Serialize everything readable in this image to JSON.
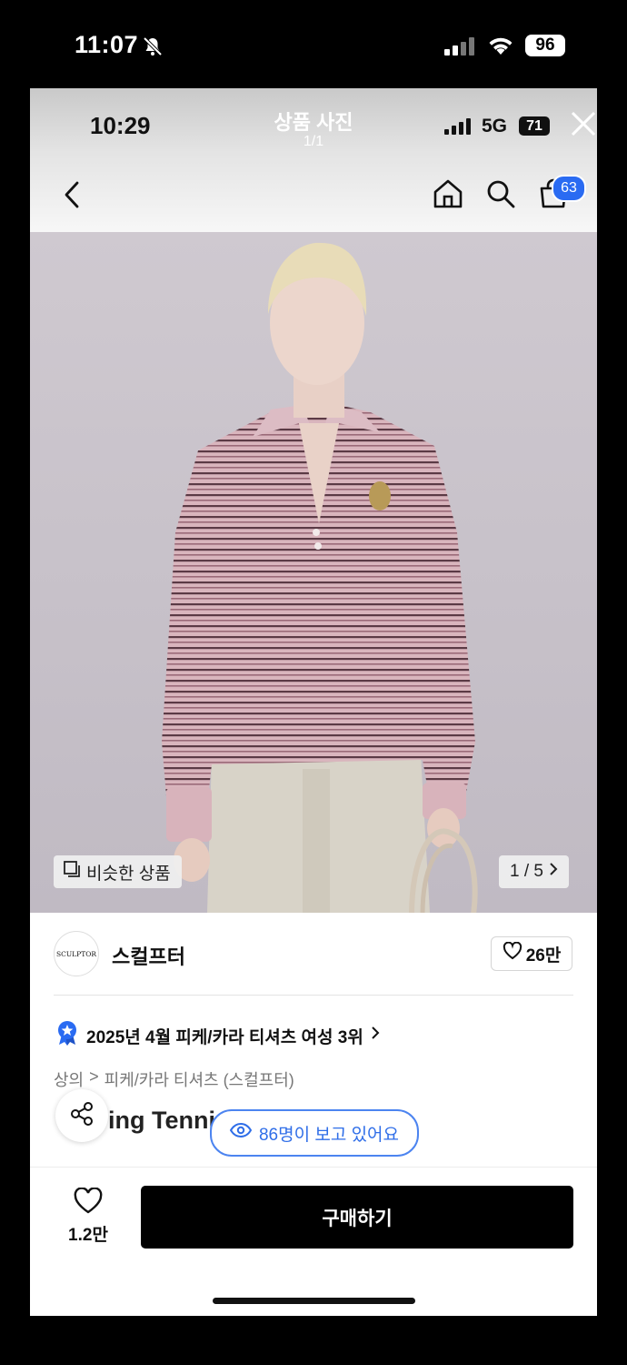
{
  "outer_status": {
    "time": "11:07",
    "battery": "96"
  },
  "inner_status": {
    "time": "10:29",
    "network": "5G",
    "battery": "71"
  },
  "viewer": {
    "title": "상품 사진",
    "counter": "1/1"
  },
  "nav": {
    "cart_count": "63",
    "icons": [
      "back-arrow-icon",
      "home-icon",
      "search-icon",
      "cart-icon"
    ]
  },
  "photo": {
    "similar_label": "비슷한 상품",
    "page_indicator": "1 / 5"
  },
  "brand": {
    "logo_text": "SCULPTOR",
    "name": "스컬프터",
    "likes": "26만"
  },
  "ranking": {
    "text": "2025년 4월 피케/카라 티셔츠 여성 3위"
  },
  "breadcrumb": {
    "level1": "상의",
    "separator": ">",
    "level2": "피케/카라 티셔츠 (스컬프터)"
  },
  "product": {
    "name_partial": "ing Tenni"
  },
  "viewers": {
    "text": "86명이 보고 있어요"
  },
  "bottom": {
    "wish_count": "1.2만",
    "buy_label": "구매하기"
  },
  "colors": {
    "accent_blue": "#2a6bf2",
    "buy_button": "#000000",
    "badge_blue": "#2a6bf2"
  }
}
